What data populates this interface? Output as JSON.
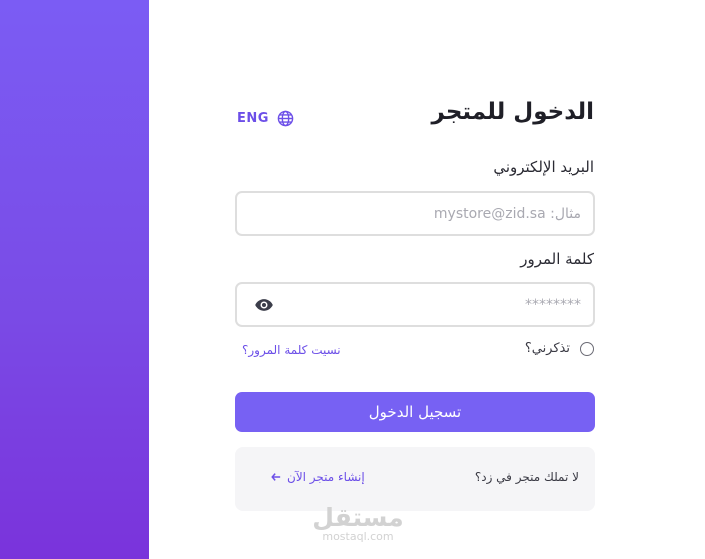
{
  "page": {
    "title": "الدخول للمتجر",
    "language_toggle": "ENG"
  },
  "form": {
    "email_label": "البريد الإلكتروني",
    "email_placeholder": "مثال: mystore@zid.sa",
    "email_value": "",
    "password_label": "كلمة المرور",
    "password_placeholder": "********",
    "password_value": "",
    "remember_label": "تذكرني؟",
    "remember_checked": false,
    "forgot_link": "نسيت كلمة المرور؟",
    "submit_label": "تسجيل الدخول"
  },
  "signup": {
    "prompt": "لا تملك متجر في زد؟",
    "link": "إنشاء متجر الآن"
  },
  "watermark": {
    "arabic": "مستقل",
    "latin": "mostaql.com"
  },
  "colors": {
    "accent": "#7761f3",
    "link": "#6c4fe8",
    "sidebar_top": "#7b5cf4",
    "sidebar_bottom": "#7a33db"
  },
  "icons": {
    "language": "globe-icon",
    "password_toggle": "eye-icon",
    "signup_arrow": "arrow-left-icon"
  }
}
